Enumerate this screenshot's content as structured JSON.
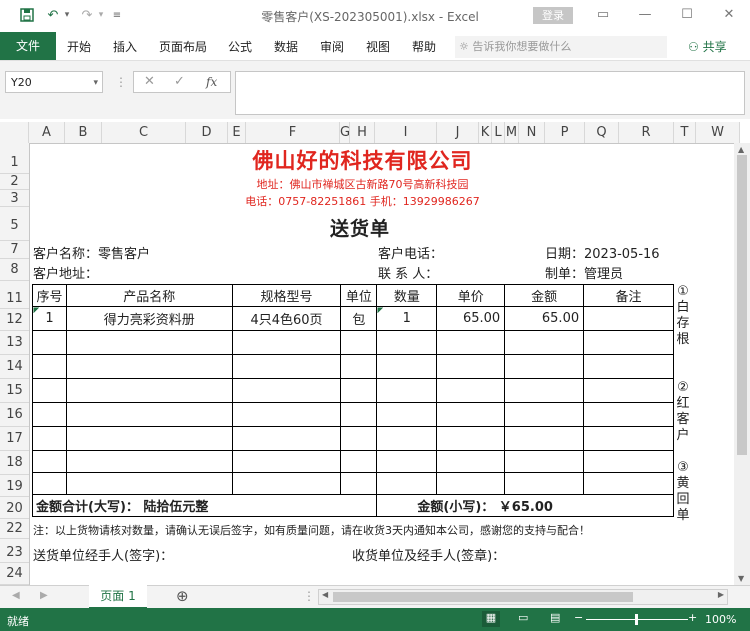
{
  "window": {
    "title": "零售客户(XS-202305001).xlsx  -  Excel",
    "login": "登录"
  },
  "ribbon": {
    "file": "文件",
    "tabs": [
      "开始",
      "插入",
      "页面布局",
      "公式",
      "数据",
      "审阅",
      "视图",
      "帮助"
    ],
    "tellme": "告诉我你想要做什么",
    "share": "共享"
  },
  "formula_bar": {
    "name_box": "Y20",
    "fx": "fx",
    "value": ""
  },
  "grid": {
    "columns": [
      "A",
      "B",
      "C",
      "D",
      "E",
      "F",
      "G",
      "H",
      "I",
      "J",
      "K",
      "L",
      "M",
      "N",
      "P",
      "Q",
      "R",
      "T",
      "W"
    ],
    "rows": [
      "1",
      "2",
      "3",
      "5",
      "7",
      "8",
      "11",
      "12",
      "13",
      "14",
      "15",
      "16",
      "17",
      "18",
      "19",
      "20",
      "22",
      "23",
      "24"
    ]
  },
  "sheet": {
    "company": "佛山好的科技有限公司",
    "address": "地址：佛山市禅城区古新路70号高新科技园",
    "phone": "电话：0757-82251861  手机：13929986267",
    "doc_title": "送货单",
    "customer_name_label": "客户名称：零售客户",
    "customer_address_label": "客户地址：",
    "customer_phone_label": "客户电话：",
    "contact_label": "联  系  人：",
    "date_label": "日期：2023-05-16",
    "maker_label": "制单：管理员",
    "table_headers": [
      "序号",
      "产品名称",
      "规格型号",
      "单位",
      "数量",
      "单价",
      "金额",
      "备注"
    ],
    "items": [
      {
        "no": "1",
        "name": "得力亮彩资料册",
        "spec": "4只4色60页",
        "unit": "包",
        "qty": "1",
        "price": "65.00",
        "amount": "65.00",
        "note": ""
      }
    ],
    "total_upper": "金额合计(大写)：  陆拾伍元整",
    "total_lower": "金额(小写)：  ￥65.00",
    "notice": "注：以上货物请核对数量，请确认无误后签字，如有质量问题，请在收货3天内通知本公司，感谢您的支持与配合！",
    "sender_sign": "送货单位经手人(签字)：",
    "receiver_sign": "收货单位及经手人(签章)：",
    "side_note": [
      "①",
      "白",
      "存",
      "根",
      "",
      "②",
      "红",
      "客",
      "户",
      "",
      "③",
      "黄",
      "回",
      "单"
    ]
  },
  "sheet_tabs": {
    "tab": "页面 1",
    "add": "⊕"
  },
  "status": {
    "left": "就绪",
    "zoom": "100%"
  }
}
